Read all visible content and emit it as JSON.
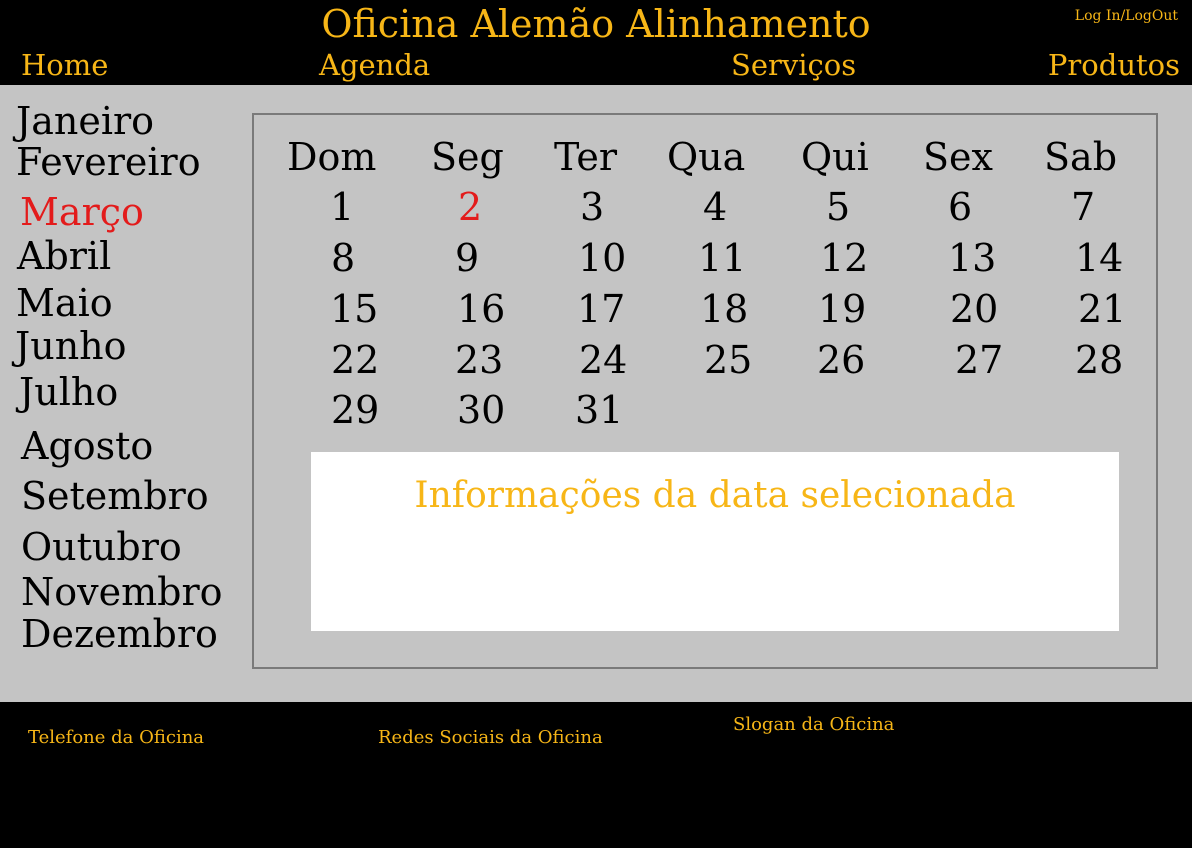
{
  "header": {
    "title": "Oficina Alemão Alinhamento",
    "login": "Log In/LogOut",
    "nav": {
      "home": "Home",
      "agenda": "Agenda",
      "servicos": "Serviços",
      "produtos": "Produtos"
    }
  },
  "months": [
    "Janeiro",
    "Fevereiro",
    "Março",
    "Abril",
    "Maio",
    "Junho",
    "Julho",
    "Agosto",
    "Setembro",
    "Outubro",
    "Novembro",
    "Dezembro"
  ],
  "selected_month": "Março",
  "calendar": {
    "weekdays": [
      "Dom",
      "Seg",
      "Ter",
      "Qua",
      "Qui",
      "Sex",
      "Sab"
    ],
    "weeks": [
      [
        "1",
        "2",
        "3",
        "4",
        "5",
        "6",
        "7"
      ],
      [
        "8",
        "9",
        "10",
        "11",
        "12",
        "13",
        "14"
      ],
      [
        "15",
        "16",
        "17",
        "18",
        "19",
        "20",
        "21"
      ],
      [
        "22",
        "23",
        "24",
        "25",
        "26",
        "27",
        "28"
      ],
      [
        "29",
        "30",
        "31"
      ]
    ],
    "selected_day": "2"
  },
  "info": {
    "title": "Informações da data selecionada"
  },
  "footer": {
    "phone": "Telefone da Oficina",
    "social": "Redes Sociais da Oficina",
    "slogan": "Slogan da Oficina"
  },
  "colors": {
    "accent": "#f7b617",
    "selected": "#e31b1b",
    "panel": "#c4c4c4",
    "bar": "#000000"
  }
}
